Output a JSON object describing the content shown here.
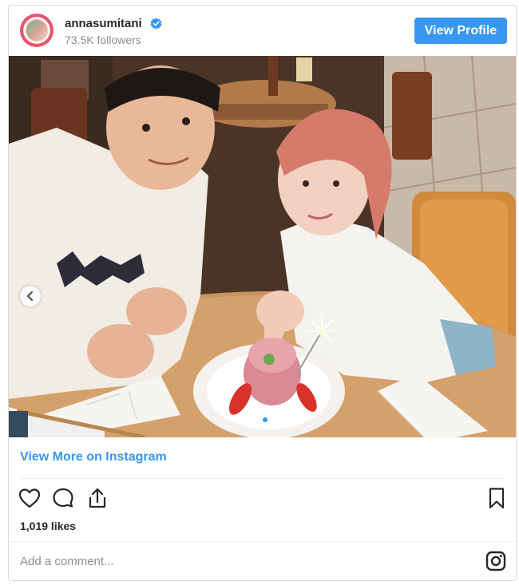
{
  "header": {
    "username": "annasumitani",
    "followers": "73.5K followers",
    "view_profile_label": "View Profile"
  },
  "post": {
    "image_alt": "Photo of two people at a restaurant table with a cake and sparkler",
    "carousel": {
      "active_index": 1,
      "count": 2
    }
  },
  "footer": {
    "view_more_label": "View More on Instagram",
    "likes": "1,019 likes",
    "comment_placeholder": "Add a comment..."
  },
  "icons": {
    "verified": "verified-badge-icon",
    "like": "heart-icon",
    "comment": "comment-bubble-icon",
    "share": "share-icon",
    "save": "bookmark-icon",
    "brand": "instagram-logo-icon",
    "carousel_prev": "chevron-left-icon"
  },
  "colors": {
    "accent": "#3897f0",
    "text": "#262626",
    "muted": "#8e8e8e",
    "border": "#dbdbdb"
  }
}
